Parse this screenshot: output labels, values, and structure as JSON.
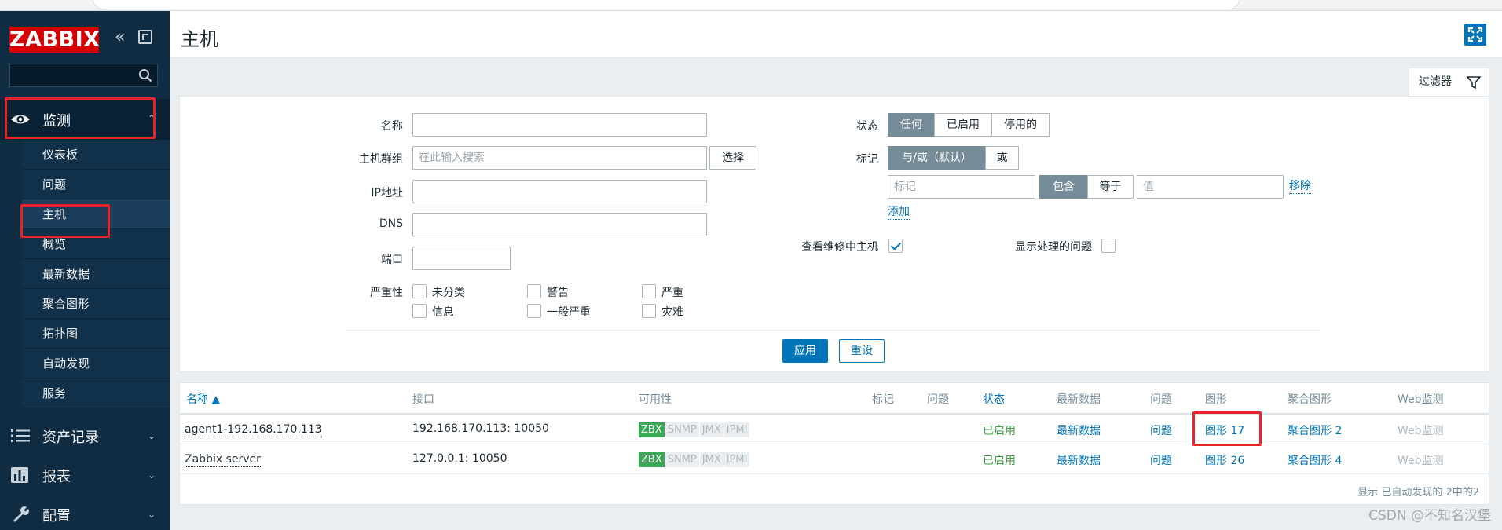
{
  "brand": {
    "logo_text": "ZABBIX"
  },
  "sidebar": {
    "top_section": "监测",
    "sub_items": [
      "仪表板",
      "问题",
      "主机",
      "概览",
      "最新数据",
      "聚合图形",
      "拓扑图",
      "自动发现",
      "服务"
    ],
    "sections": [
      "资产记录",
      "报表",
      "配置"
    ]
  },
  "header": {
    "title": "主机"
  },
  "filter": {
    "tab_label": "过滤器",
    "labels": {
      "name": "名称",
      "host_group": "主机群组",
      "ip": "IP地址",
      "dns": "DNS",
      "port": "端口",
      "severity": "严重性",
      "status": "状态",
      "tags": "标记",
      "show_maintenance": "查看维修中主机",
      "show_suppressed": "显示处理的问题"
    },
    "host_group_placeholder": "在此输入搜索",
    "select_button": "选择",
    "status_options": [
      "任何",
      "已启用",
      "停用的"
    ],
    "tag_mode_options": [
      "与/或（默认）",
      "或"
    ],
    "tag_name_placeholder": "标记",
    "tag_operator_options": [
      "包含",
      "等于"
    ],
    "tag_value_placeholder": "值",
    "remove_link": "移除",
    "add_link": "添加",
    "severities": [
      "未分类",
      "警告",
      "严重",
      "信息",
      "一般严重",
      "灾难"
    ],
    "apply_button": "应用",
    "reset_button": "重设"
  },
  "table": {
    "columns": [
      "名称 ▲",
      "接口",
      "可用性",
      "标记",
      "问题",
      "状态",
      "最新数据",
      "问题",
      "图形",
      "聚合图形",
      "Web监测"
    ],
    "rows": [
      {
        "name": "agent1-192.168.170.113",
        "interface": "192.168.170.113: 10050",
        "availability": [
          "ZBX",
          "SNMP",
          "JMX",
          "IPMI"
        ],
        "status": "已启用",
        "latest_data": "最新数据",
        "problems": "问题",
        "graphs": "图形 17",
        "screens": "聚合图形 2",
        "web": "Web监测"
      },
      {
        "name": "Zabbix server",
        "interface": "127.0.0.1: 10050",
        "availability": [
          "ZBX",
          "SNMP",
          "JMX",
          "IPMI"
        ],
        "status": "已启用",
        "latest_data": "最新数据",
        "problems": "问题",
        "graphs": "图形 26",
        "screens": "聚合图形 4",
        "web": "Web监测"
      }
    ],
    "footer": "显示 已自动发现的 2中的2"
  },
  "watermark": "CSDN @不知名汉堡",
  "colors": {
    "accent": "#0275b8",
    "sidebar": "#0f2c43",
    "logo": "#d40000",
    "enabled": "#429e47",
    "highlight": "#e8232a"
  }
}
